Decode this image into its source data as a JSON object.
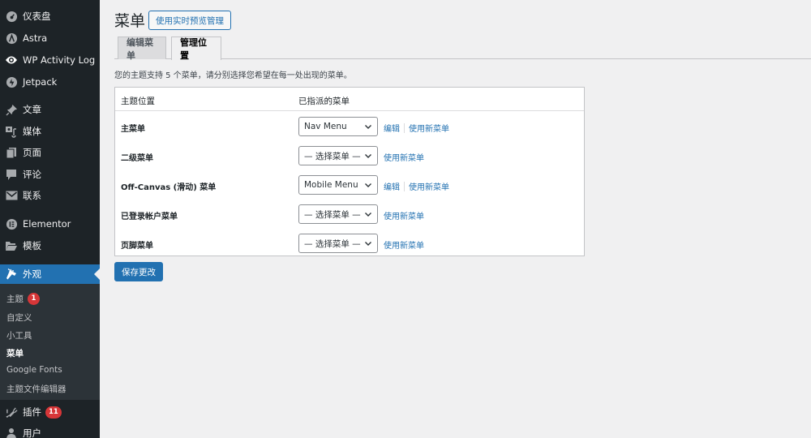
{
  "sidebar": {
    "items": [
      {
        "label": "仪表盘",
        "icon": "dashboard-icon"
      },
      {
        "label": "Astra",
        "icon": "astra-icon"
      },
      {
        "label": "WP Activity Log",
        "icon": "eye-icon"
      },
      {
        "label": "Jetpack",
        "icon": "jetpack-icon"
      },
      {
        "label": "文章",
        "icon": "pin-icon"
      },
      {
        "label": "媒体",
        "icon": "media-icon"
      },
      {
        "label": "页面",
        "icon": "pages-icon"
      },
      {
        "label": "评论",
        "icon": "comment-icon"
      },
      {
        "label": "联系",
        "icon": "mail-icon"
      },
      {
        "label": "Elementor",
        "icon": "elementor-icon"
      },
      {
        "label": "模板",
        "icon": "folder-icon"
      },
      {
        "label": "外观",
        "icon": "brush-icon",
        "current": true
      },
      {
        "label": "插件",
        "icon": "plugin-icon",
        "badge": "11"
      },
      {
        "label": "用户",
        "icon": "user-icon"
      }
    ],
    "submenu": [
      {
        "label": "主题",
        "badge": "1"
      },
      {
        "label": "自定义"
      },
      {
        "label": "小工具"
      },
      {
        "label": "菜单",
        "active": true
      },
      {
        "label": "Google Fonts"
      },
      {
        "label": "主题文件编辑器"
      }
    ]
  },
  "header": {
    "title": "菜单",
    "live_preview_button": "使用实时预览管理"
  },
  "tabs": [
    {
      "label": "编辑菜单",
      "active": false
    },
    {
      "label": "管理位置",
      "active": true
    }
  ],
  "intro_text": "您的主题支持 5 个菜单，请分别选择您希望在每一处出现的菜单。",
  "table": {
    "headers": [
      "主题位置",
      "已指派的菜单"
    ],
    "rows": [
      {
        "location": "主菜单",
        "selected": "Nav Menu",
        "edit_link": "编辑",
        "new_link": "使用新菜单"
      },
      {
        "location": "二级菜单",
        "selected": "— 选择菜单 —",
        "new_link": "使用新菜单"
      },
      {
        "location": "Off-Canvas (滑动) 菜单",
        "selected": "Mobile Menu",
        "edit_link": "编辑",
        "new_link": "使用新菜单"
      },
      {
        "location": "已登录帐户菜单",
        "selected": "— 选择菜单 —",
        "new_link": "使用新菜单"
      },
      {
        "location": "页脚菜单",
        "selected": "— 选择菜单 —",
        "new_link": "使用新菜单"
      }
    ]
  },
  "save_button": "保存更改",
  "colors": {
    "accent": "#2271b1",
    "sidebar_bg": "#1d2327",
    "submenu_bg": "#2c3338",
    "badge": "#d63638",
    "page_bg": "#f0f0f1"
  }
}
